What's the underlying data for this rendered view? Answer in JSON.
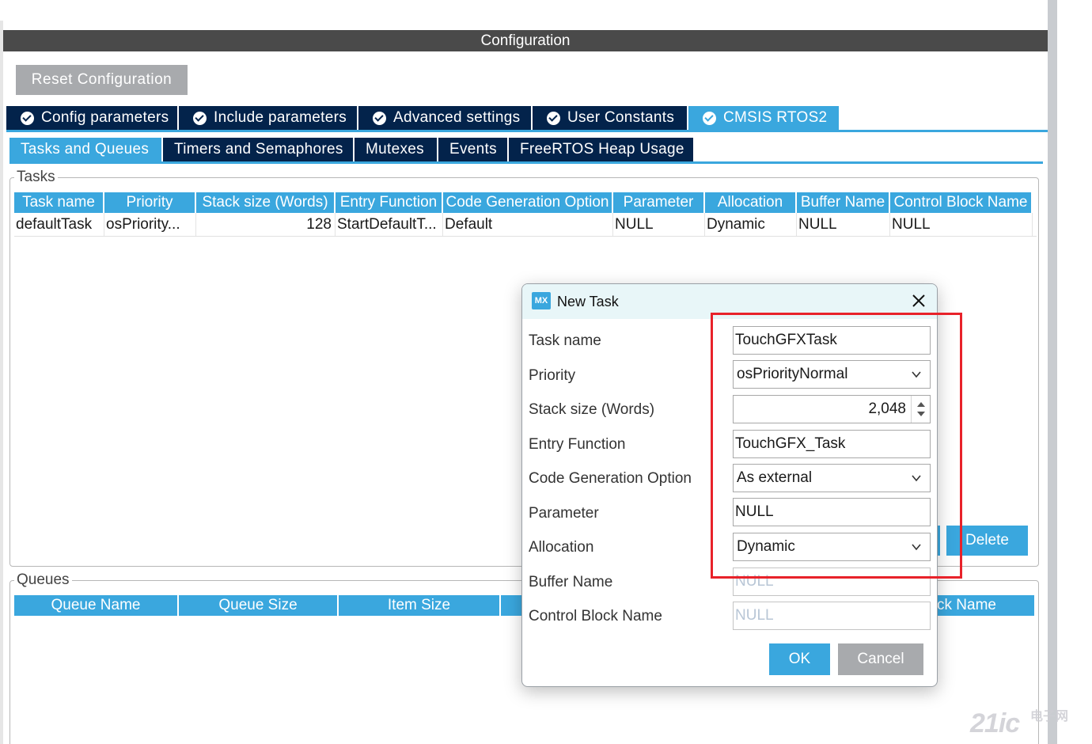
{
  "header": {
    "title": "Configuration",
    "reset_label": "Reset Configuration"
  },
  "tabs": [
    {
      "label": "Config parameters",
      "active": false
    },
    {
      "label": "Include parameters",
      "active": false
    },
    {
      "label": "Advanced settings",
      "active": false
    },
    {
      "label": "User Constants",
      "active": false
    },
    {
      "label": "CMSIS RTOS2",
      "active": true
    }
  ],
  "subtabs": [
    {
      "label": "Tasks and Queues",
      "active": true
    },
    {
      "label": "Timers and Semaphores",
      "active": false
    },
    {
      "label": "Mutexes",
      "active": false
    },
    {
      "label": "Events",
      "active": false
    },
    {
      "label": "FreeRTOS Heap Usage",
      "active": false
    }
  ],
  "tasks": {
    "group_label": "Tasks",
    "columns": [
      "Task name",
      "Priority",
      "Stack size (Words)",
      "Entry Function",
      "Code Generation Option",
      "Parameter",
      "Allocation",
      "Buffer Name",
      "Control Block Name"
    ],
    "rows": [
      [
        "defaultTask",
        "osPriority...",
        "128",
        "StartDefaultT...",
        "Default",
        "NULL",
        "Dynamic",
        "NULL",
        "NULL"
      ]
    ],
    "delete_label": "Delete"
  },
  "queues": {
    "group_label": "Queues",
    "columns": [
      "Queue Name",
      "Queue Size",
      "Item Size"
    ],
    "partial_column": "ck Name"
  },
  "dialog": {
    "logo": "MX",
    "title": "New Task",
    "labels": {
      "task_name": "Task name",
      "priority": "Priority",
      "stack_size": "Stack size (Words)",
      "entry_function": "Entry Function",
      "code_gen": "Code Generation Option",
      "parameter": "Parameter",
      "allocation": "Allocation",
      "buffer_name": "Buffer Name",
      "control_block": "Control Block Name"
    },
    "values": {
      "task_name": "TouchGFXTask",
      "priority": "osPriorityNormal",
      "stack_size": "2,048",
      "entry_function": "TouchGFX_Task",
      "code_gen": "As external",
      "parameter": "NULL",
      "allocation": "Dynamic",
      "buffer_name": "NULL",
      "control_block": "NULL"
    },
    "ok_label": "OK",
    "cancel_label": "Cancel"
  },
  "watermark": {
    "main": "21ic",
    "sub1": "电子网"
  },
  "colors": {
    "accent": "#3aa7de",
    "tab_dark": "#03234b",
    "title_bar": "#4a4a4a",
    "highlight": "#e8222a"
  }
}
